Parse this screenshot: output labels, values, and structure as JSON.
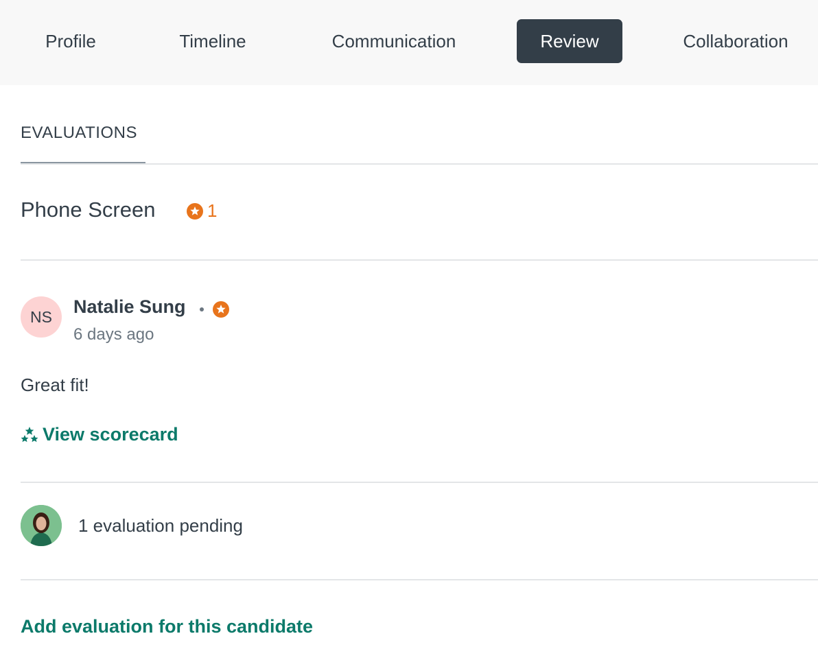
{
  "tabs": [
    {
      "label": "Profile",
      "active": false
    },
    {
      "label": "Timeline",
      "active": false
    },
    {
      "label": "Communication",
      "active": false
    },
    {
      "label": "Review",
      "active": true
    },
    {
      "label": "Collaboration",
      "active": false
    }
  ],
  "section": {
    "label": "EVALUATIONS"
  },
  "stage": {
    "title": "Phone Screen",
    "rating_icon": "star-circle-icon",
    "rating_count": "1"
  },
  "evaluation": {
    "reviewer_initials": "NS",
    "reviewer_name": "Natalie Sung",
    "rating_icon": "star-circle-icon",
    "time": "6 days ago",
    "comment": "Great fit!",
    "scorecard_icon": "stars-icon",
    "scorecard_link": "View scorecard"
  },
  "pending": {
    "text": "1 evaluation pending"
  },
  "add_evaluation": {
    "label": "Add evaluation for this candidate"
  },
  "colors": {
    "accent_dark": "#333e48",
    "link_green": "#0c7a6a",
    "rating_orange": "#e8741c",
    "avatar_pink": "#fdd3d3"
  }
}
